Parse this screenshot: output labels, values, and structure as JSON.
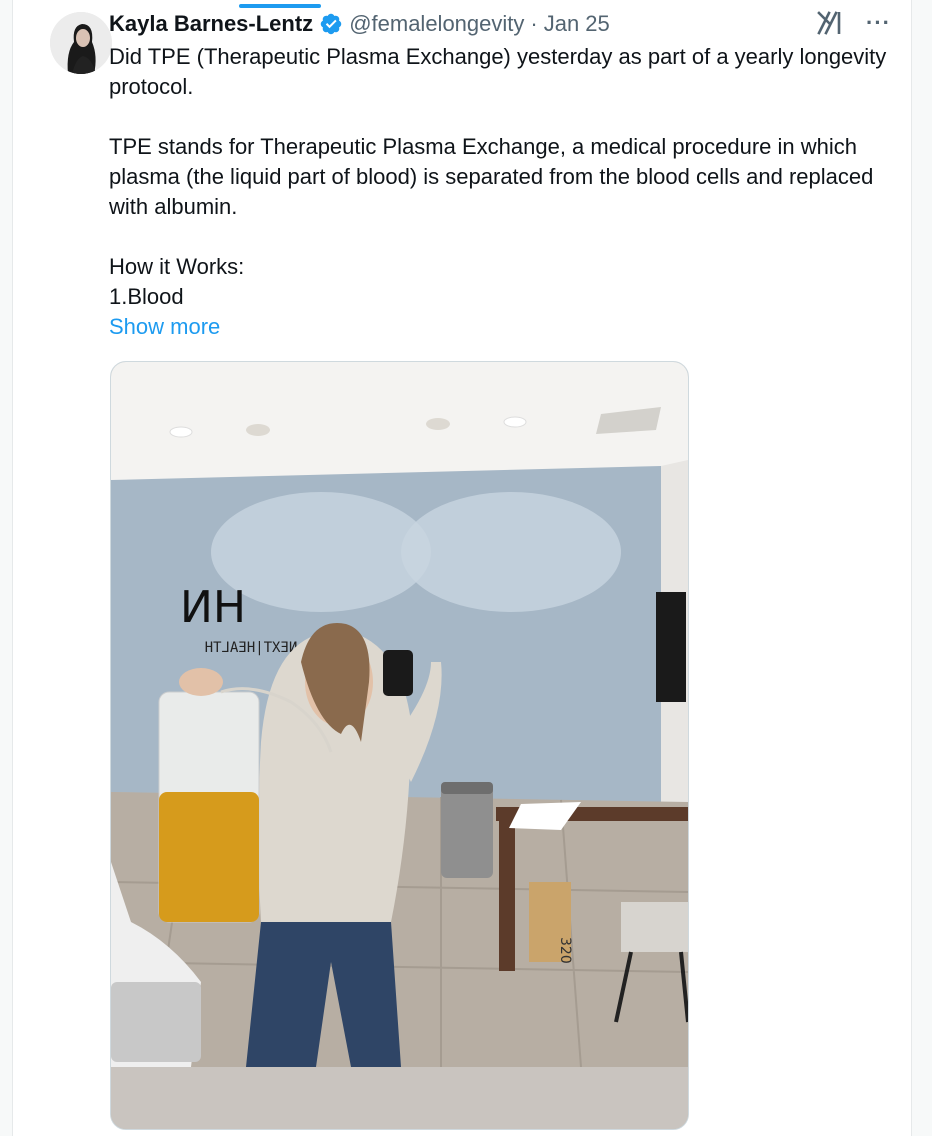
{
  "tweet": {
    "author_name": "Kayla Barnes-Lentz",
    "handle": "@femalelongevity",
    "separator": "·",
    "date": "Jan 25",
    "paragraphs": [
      "Did TPE (Therapeutic Plasma Exchange) yesterday as part of a yearly longevity protocol.",
      "TPE stands for Therapeutic Plasma Exchange, a medical procedure in which plasma (the liquid part of blood) is separated from the blood cells and replaced with albumin.",
      "How it Works:",
      "1.Blood"
    ],
    "show_more": "Show more",
    "more_glyph": "···"
  },
  "photo": {
    "wall_sign": "NEXT|HEALTH",
    "box_text": "320"
  },
  "colors": {
    "accent": "#1d9bf0",
    "text": "#0f1419",
    "secondary": "#536471"
  }
}
